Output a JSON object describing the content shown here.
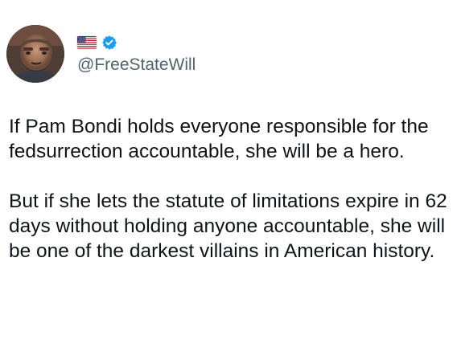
{
  "tweet": {
    "avatar_icon": "profile-avatar",
    "flag_icon": "us-flag-icon",
    "verified_icon": "verified-badge-icon",
    "verified_color": "#1d9bf0",
    "handle": "@FreeStateWill",
    "paragraphs": [
      "If Pam Bondi holds everyone responsible for the fedsurrection accountable, she will be a hero.",
      "But if she lets the statute of limitations expire in 62 days without holding anyone accountable, she will be one of the darkest villains in American history."
    ]
  }
}
